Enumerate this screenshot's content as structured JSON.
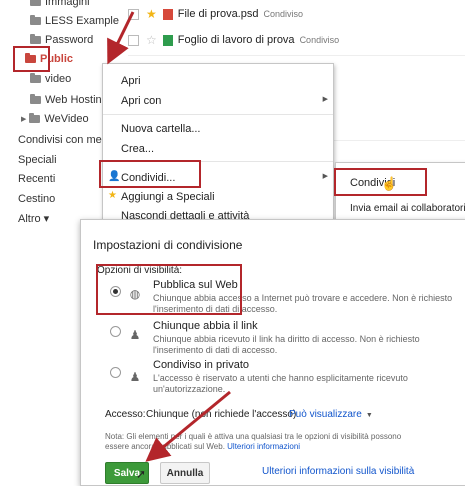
{
  "sidebar": {
    "items": [
      {
        "label": "Immagini",
        "icon": "folder-icon"
      },
      {
        "label": "LESS Example",
        "icon": "folder-icon"
      },
      {
        "label": "Password",
        "icon": "folder-icon"
      },
      {
        "label": "Public",
        "icon": "folder-icon"
      },
      {
        "label": "video",
        "icon": "folder-icon"
      },
      {
        "label": "Web Hosting",
        "icon": "folder-icon"
      },
      {
        "label": "WeVideo",
        "icon": "folder-icon"
      }
    ],
    "nav": [
      {
        "label": "Condivisi con me"
      },
      {
        "label": "Speciali"
      },
      {
        "label": "Recenti"
      },
      {
        "label": "Cestino"
      },
      {
        "label": "Altro ▾"
      }
    ]
  },
  "files": [
    {
      "name": "File di prova.psd",
      "badge": "Condiviso",
      "starred": true,
      "icon_color": "#d6493b"
    },
    {
      "name": "Foglio di lavoro di prova",
      "badge": "Condiviso",
      "starred": false,
      "icon_color": "#2e9c4d"
    }
  ],
  "context_menu": {
    "items": [
      "Apri",
      "Apri con",
      "Nuova cartella...",
      "Crea...",
      "Condividi...",
      "Aggiungi a Speciali",
      "Nascondi dettagli e attività"
    ],
    "submenu": [
      "Condividi",
      "Invia email ai collaboratori..."
    ]
  },
  "dialog": {
    "title": "Impostazioni di condivisione",
    "visibility_label": "Opzioni di visibilità:",
    "options": [
      {
        "title": "Pubblica sul Web",
        "desc": "Chiunque abbia accesso a Internet può trovare e accedere. Non è richiesto l'inserimento di dati di accesso.",
        "selected": true,
        "icon": "globe-icon"
      },
      {
        "title": "Chiunque abbia il link",
        "desc": "Chiunque abbia ricevuto il link ha diritto di accesso. Non è richiesto l'inserimento di dati di accesso.",
        "selected": false,
        "icon": "link-person-icon"
      },
      {
        "title": "Condiviso in privato",
        "desc": "L'accesso è riservato a utenti che hanno esplicitamente ricevuto un'autorizzazione.",
        "selected": false,
        "icon": "private-person-icon"
      }
    ],
    "access_label": "Accesso:",
    "access_value": "Chiunque (non richiede l'accesso)",
    "permission": "Può visualizzare",
    "note": "Nota: Gli elementi per i quali è attiva una qualsiasi tra le opzioni di visibilità possono essere ancora pubblicati sul Web.",
    "note_link": "Ulteriori informazioni",
    "save_label": "Salva",
    "cancel_label": "Annulla",
    "footer_link": "Ulteriori informazioni sulla visibilità"
  },
  "colors": {
    "annotation_red": "#b3262b",
    "save_green": "#3d9a3a",
    "link_blue": "#1155cc"
  }
}
